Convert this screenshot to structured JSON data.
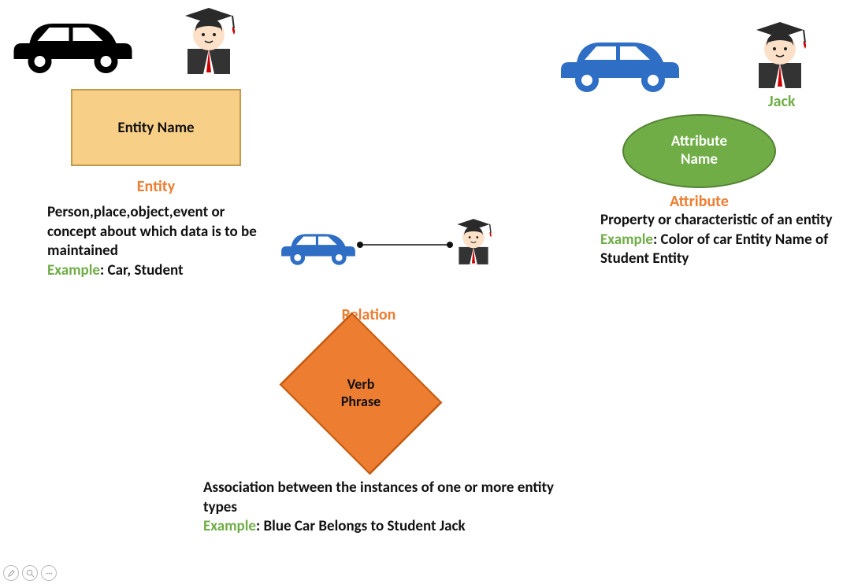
{
  "entity": {
    "box_label": "Entity Name",
    "title": "Entity",
    "description": "Person,place,object,event or concept about which data is to be maintained",
    "example_label": "Example",
    "example_text": ": Car, Student"
  },
  "attribute": {
    "ellipse_label_line1": "Attribute",
    "ellipse_label_line2": "Name",
    "title": "Attribute",
    "jack_label": "Jack",
    "description": "Property or characteristic of an entity",
    "example_label": "Example",
    "example_text": ": Color of car Entity Name of Student Entity"
  },
  "relation": {
    "title": "Relation",
    "diamond_line1": "Verb",
    "diamond_line2": "Phrase",
    "description": "Association between the instances of one or more entity types",
    "example_label": "Example",
    "example_text": ": Blue Car Belongs to Student Jack"
  },
  "icons": {
    "car_black": "car-icon",
    "car_blue": "car-icon",
    "student": "student-icon"
  }
}
